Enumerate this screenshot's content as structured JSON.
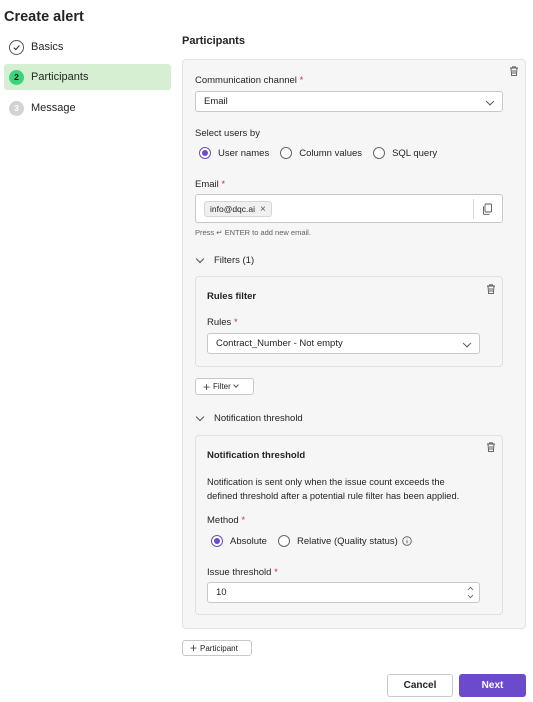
{
  "page_title": "Create alert",
  "steps": [
    {
      "label": "Basics",
      "marker": "",
      "state": "done"
    },
    {
      "label": "Participants",
      "marker": "2",
      "state": "active"
    },
    {
      "label": "Message",
      "marker": "3",
      "state": "pending"
    }
  ],
  "section_title": "Participants",
  "channel": {
    "label": "Communication channel",
    "required": "*",
    "value": "Email"
  },
  "select_users": {
    "label": "Select users by",
    "options": [
      "User names",
      "Column values",
      "SQL query"
    ],
    "selected": "User names"
  },
  "email": {
    "label": "Email",
    "required": "*",
    "tag": "info@dqc.ai",
    "tag_remove": "×",
    "hint": "Press ↵ ENTER to add new email."
  },
  "filters": {
    "toggle_label": "Filters (1)",
    "card_title": "Rules filter",
    "rules_label": "Rules",
    "required": "*",
    "rules_value": "Contract_Number - Not empty",
    "add_filter_label": "Filter"
  },
  "threshold": {
    "toggle_label": "Notification threshold",
    "card_title": "Notification threshold",
    "description_line1": "Notification is sent only when the issue count exceeds the",
    "description_line2": "defined threshold after a potential rule filter has been applied.",
    "method_label": "Method",
    "required": "*",
    "method_options": [
      "Absolute",
      "Relative (Quality status)"
    ],
    "method_selected": "Absolute",
    "issue_label": "Issue threshold",
    "issue_value": "10"
  },
  "add_participant_label": "Participant",
  "buttons": {
    "cancel": "Cancel",
    "next": "Next"
  },
  "colors": {
    "accent": "#6b4bcc",
    "active_step_bg": "#d6efd2",
    "step_active_circle": "#3ad47a",
    "required": "#c4314b"
  },
  "icons": [
    "check-circle-icon",
    "trash-icon",
    "chevron-down-icon",
    "copy-icon",
    "plus-icon",
    "info-icon",
    "spin-up-icon",
    "spin-down-icon"
  ]
}
